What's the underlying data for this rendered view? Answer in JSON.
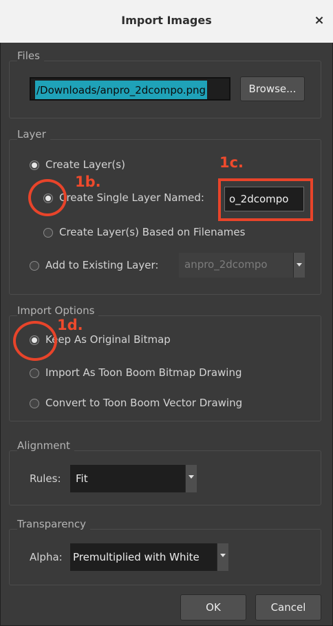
{
  "window": {
    "title": "Import Images",
    "close_icon": "×"
  },
  "files": {
    "group_title": "Files",
    "path_value": "/Downloads/anpro_2dcompo.png",
    "browse_label": "Browse..."
  },
  "layer": {
    "group_title": "Layer",
    "create_layers_label": "Create Layer(s)",
    "single_layer_label": "Create Single Layer Named:",
    "single_layer_value": "o_2dcompo",
    "filenames_label": "Create Layer(s) Based on Filenames",
    "existing_label": "Add to Existing Layer:",
    "existing_value": "anpro_2dcompo"
  },
  "import_options": {
    "group_title": "Import Options",
    "keep_label": "Keep As Original Bitmap",
    "toonboom_bitmap_label": "Import As Toon Boom Bitmap Drawing",
    "toonboom_vector_label": "Convert to Toon Boom Vector Drawing"
  },
  "alignment": {
    "group_title": "Alignment",
    "rules_label": "Rules:",
    "rules_value": "Fit"
  },
  "transparency": {
    "group_title": "Transparency",
    "alpha_label": "Alpha:",
    "alpha_value": "Premultiplied with White"
  },
  "buttons": {
    "ok_label": "OK",
    "cancel_label": "Cancel"
  },
  "annotations": {
    "label_1b": "1b.",
    "label_1c": "1c.",
    "label_1d": "1d.",
    "color": "#e8442a"
  }
}
